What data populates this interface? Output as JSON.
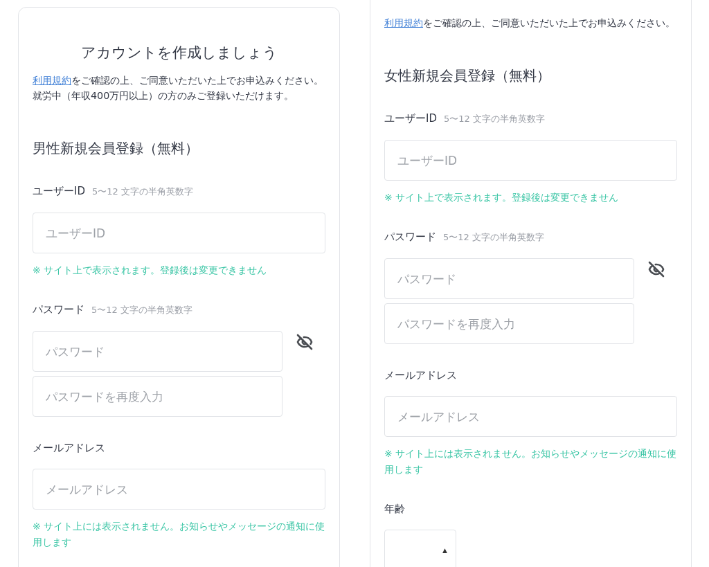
{
  "panels": [
    {
      "kind": "card",
      "title": "アカウントを作成しましょう",
      "terms": {
        "link": "利用規約",
        "text": "をご確認の上、ご同意いただいた上でお申込みください。"
      },
      "notice": "就労中（年収400万円以上）の方のみご登録いただけます。",
      "heading": "男性新規会員登録（無料）",
      "fields": [
        {
          "kind": "text",
          "label": "ユーザーID",
          "hint": "5〜12 文字の半角英数字",
          "placeholders": [
            "ユーザーID"
          ],
          "note": "※ サイト上で表示されます。登録後は変更できません"
        },
        {
          "kind": "password",
          "label": "パスワード",
          "hint": "5〜12 文字の半角英数字",
          "placeholders": [
            "パスワード",
            "パスワードを再度入力"
          ]
        },
        {
          "kind": "text",
          "label": "メールアドレス",
          "placeholders": [
            "メールアドレス"
          ],
          "note": "※ サイト上には表示されません。お知らせやメッセージの通知に使用します"
        }
      ]
    },
    {
      "kind": "scrolled",
      "terms": {
        "link": "利用規約",
        "text": "をご確認の上、ご同意いただいた上でお申込みください。"
      },
      "heading": "女性新規会員登録（無料）",
      "fields": [
        {
          "kind": "text",
          "label": "ユーザーID",
          "hint": "5〜12 文字の半角英数字",
          "placeholders": [
            "ユーザーID"
          ],
          "note": "※ サイト上で表示されます。登録後は変更できません"
        },
        {
          "kind": "password",
          "label": "パスワード",
          "hint": "5〜12 文字の半角英数字",
          "placeholders": [
            "パスワード",
            "パスワードを再度入力"
          ]
        },
        {
          "kind": "text",
          "label": "メールアドレス",
          "placeholders": [
            "メールアドレス"
          ],
          "note": "※ サイト上には表示されません。お知らせやメッセージの通知に使用します"
        },
        {
          "kind": "select",
          "label": "年齢",
          "glyph": "▲"
        }
      ]
    }
  ]
}
